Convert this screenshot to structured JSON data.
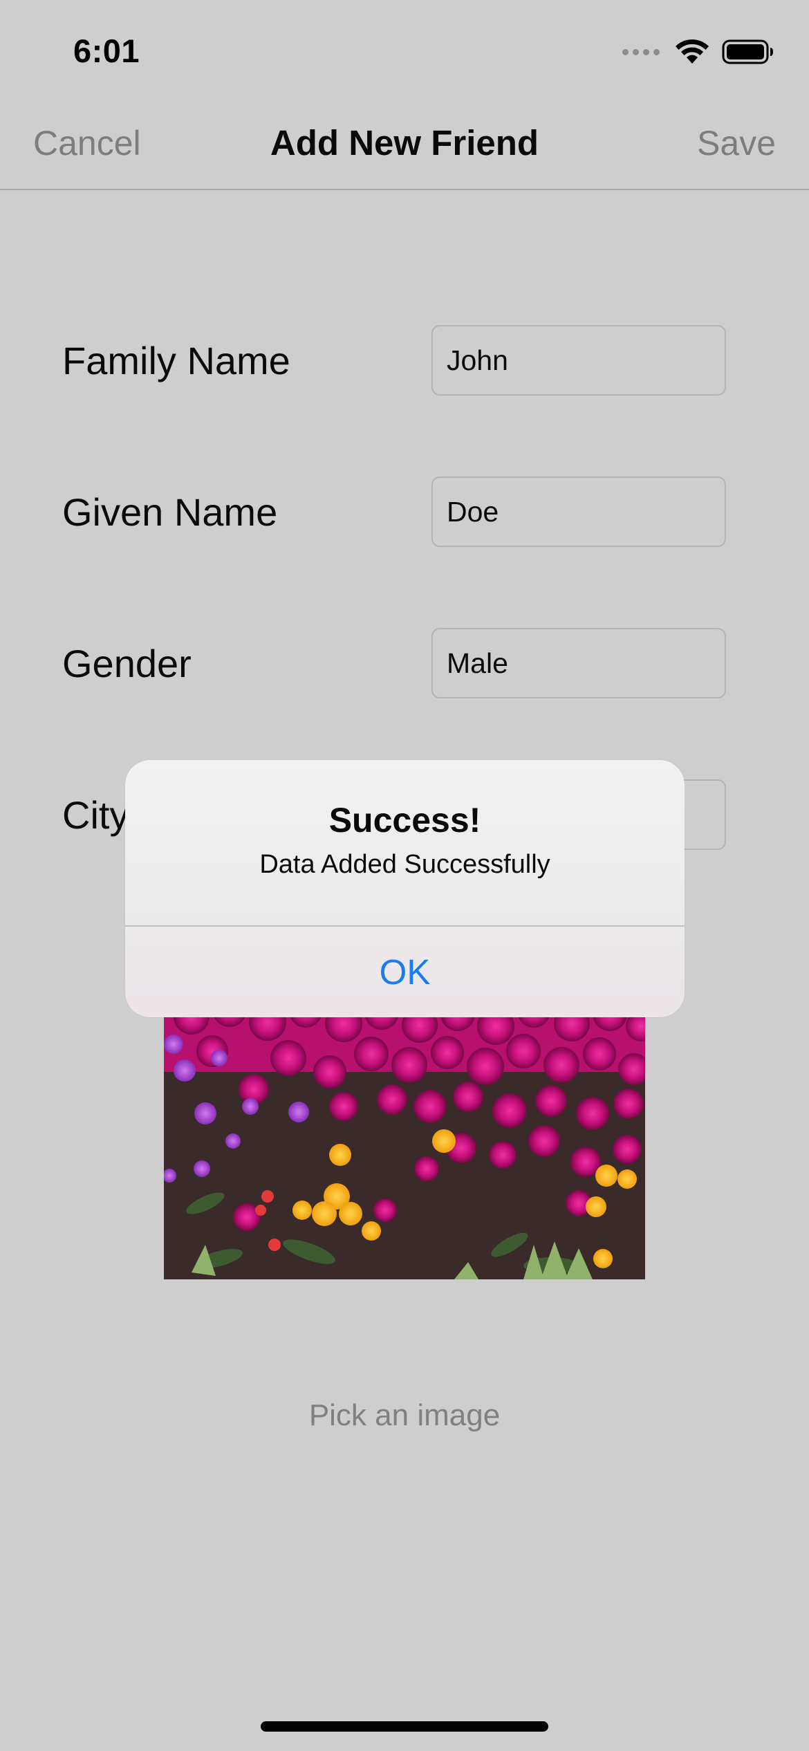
{
  "status_bar": {
    "time": "6:01"
  },
  "nav": {
    "cancel_label": "Cancel",
    "title": "Add New Friend",
    "save_label": "Save"
  },
  "form": {
    "family_name": {
      "label": "Family Name",
      "value": "John"
    },
    "given_name": {
      "label": "Given Name",
      "value": "Doe"
    },
    "gender": {
      "label": "Gender",
      "value": "Male"
    },
    "city": {
      "label": "City",
      "value": ""
    }
  },
  "pick_image_label": "Pick an image",
  "alert": {
    "title": "Success!",
    "message": "Data Added Successfully",
    "ok_label": "OK"
  },
  "colors": {
    "background": "#cecece",
    "accent": "#1a7cf2",
    "nav_button": "#7d7d7d"
  },
  "icons": [
    "cellular-signal-icon",
    "wifi-icon",
    "battery-icon"
  ]
}
